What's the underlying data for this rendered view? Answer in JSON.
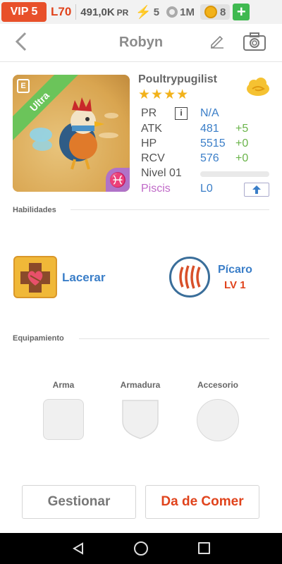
{
  "status": {
    "vip": "VIP 5",
    "level": "L70",
    "pr_value": "491,0K",
    "pr_unit": "PR",
    "energy": "5",
    "paw_count": "1M",
    "gold": "8"
  },
  "header": {
    "title": "Robyn"
  },
  "pet": {
    "name": "Poultrypugilist",
    "stars": "★★★★",
    "rarity": "Ultra",
    "zodiac_symbol": "♓",
    "stats": {
      "pr_label": "PR",
      "pr_info": "i",
      "pr_value": "N/A",
      "atk_label": "ATK",
      "atk_value": "481",
      "atk_bonus": "+5",
      "hp_label": "HP",
      "hp_value": "5515",
      "hp_bonus": "+0",
      "rcv_label": "RCV",
      "rcv_value": "576",
      "rcv_bonus": "+0",
      "nivel_label": "Nivel 01",
      "nivel_progress": 0,
      "zodiac_label": "Piscis",
      "zodiac_level": "L0"
    }
  },
  "sections": {
    "abilities": "Habilidades",
    "equipment": "Equipamiento"
  },
  "skill": {
    "name": "Lacerar"
  },
  "class": {
    "name": "Pícaro",
    "level": "LV 1"
  },
  "equipment": {
    "weapon": "Arma",
    "armor": "Armadura",
    "accessory": "Accesorio"
  },
  "buttons": {
    "manage": "Gestionar",
    "feed": "Da de Comer"
  },
  "colors": {
    "accent_blue": "#3a7ec8",
    "accent_red": "#e0431c",
    "bonus_green": "#6ab44a",
    "zodiac_purple": "#b073c8",
    "ultra_green": "#6bc45a"
  }
}
